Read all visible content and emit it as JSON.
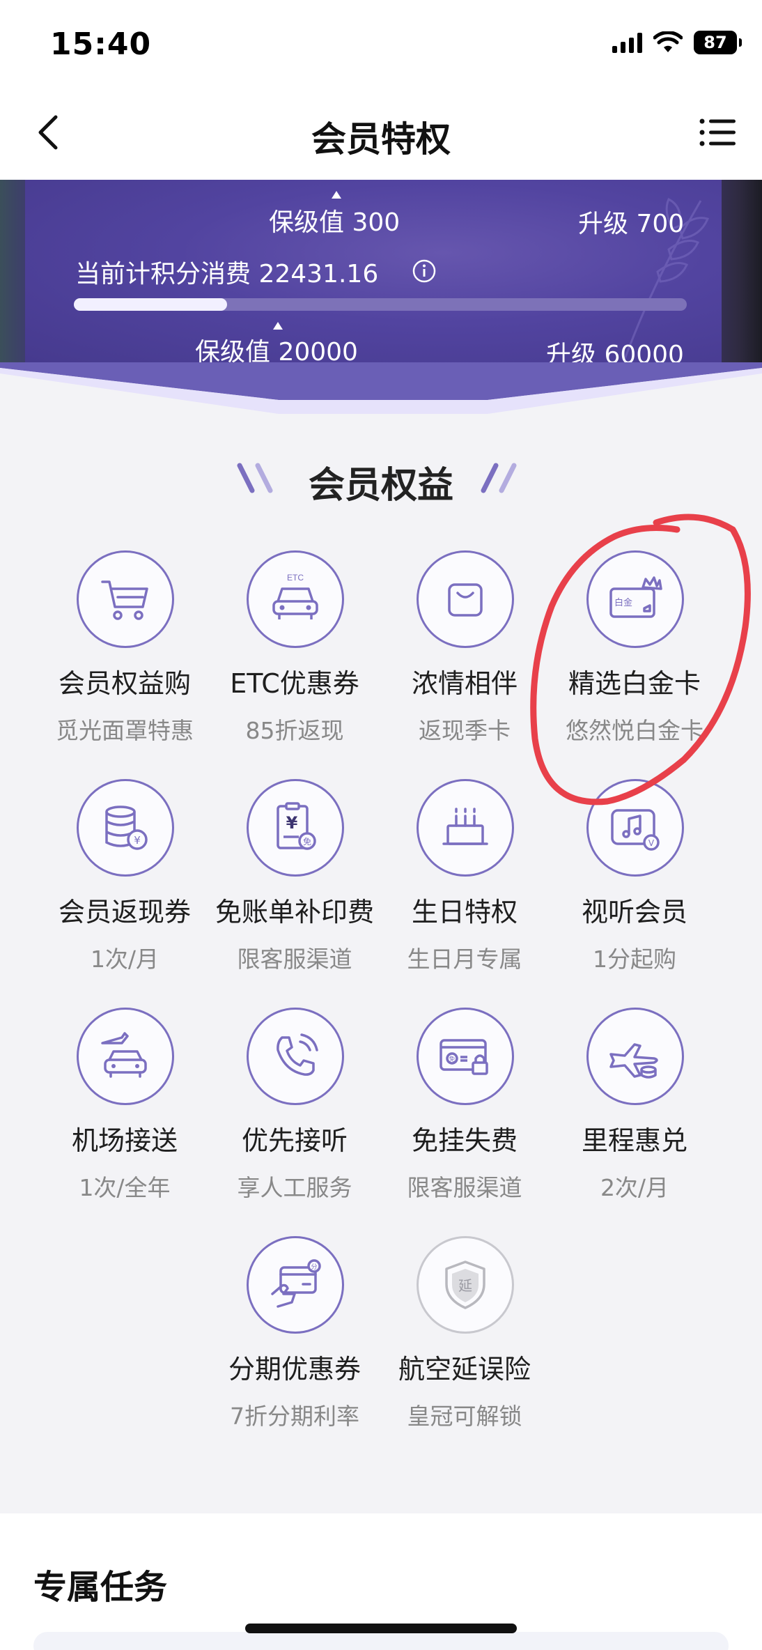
{
  "status_bar": {
    "time": "15:40",
    "battery": "87"
  },
  "nav": {
    "title": "会员特权",
    "back_icon": "chevron-left-icon",
    "menu_icon": "list-icon"
  },
  "banner": {
    "top_keep_label": "保级值 300",
    "top_upgrade_label": "升级 700",
    "points_label": "当前计积分消费 22431.16",
    "progress": 0.25,
    "bottom_keep_label": "保级值 20000",
    "bottom_upgrade_label": "升级 60000"
  },
  "benefits": {
    "section_title": "会员权益",
    "items": [
      {
        "icon": "shopping-cart-icon",
        "title": "会员权益购",
        "sub": "觅光面罩特惠"
      },
      {
        "icon": "etc-car-icon",
        "title": "ETC优惠券",
        "sub": "85折返现",
        "icon_text": "ETC"
      },
      {
        "icon": "shopping-bag-icon",
        "title": "浓情相伴",
        "sub": "返现季卡"
      },
      {
        "icon": "platinum-card-icon",
        "title": "精选白金卡",
        "sub": "悠然悦白金卡",
        "icon_text": "白金"
      },
      {
        "icon": "coin-stack-icon",
        "title": "会员返现券",
        "sub": "1次/月",
        "icon_text": "¥"
      },
      {
        "icon": "bill-icon",
        "title": "免账单补印费",
        "sub": "限客服渠道",
        "icon_text": "¥",
        "icon_badge": "免"
      },
      {
        "icon": "birthday-cake-icon",
        "title": "生日特权",
        "sub": "生日月专属"
      },
      {
        "icon": "music-video-icon",
        "title": "视听会员",
        "sub": "1分起购",
        "icon_badge": "V"
      },
      {
        "icon": "airport-car-icon",
        "title": "机场接送",
        "sub": "1次/全年"
      },
      {
        "icon": "phone-icon",
        "title": "优先接听",
        "sub": "享人工服务"
      },
      {
        "icon": "card-lock-icon",
        "title": "免挂失费",
        "sub": "限客服渠道",
        "icon_badge": "免"
      },
      {
        "icon": "plane-coins-icon",
        "title": "里程惠兑",
        "sub": "2次/月"
      },
      {
        "icon": "card-hand-icon",
        "title": "分期优惠券",
        "sub": "7折分期利率",
        "icon_badge": "分"
      },
      {
        "icon": "shield-icon",
        "title": "航空延误险",
        "sub": "皇冠可解锁",
        "icon_text": "延"
      }
    ]
  },
  "tasks": {
    "title": "专属任务"
  },
  "colors": {
    "accent": "#7b6fc0",
    "banner": "#5244a0",
    "annotation": "#e8404a"
  }
}
